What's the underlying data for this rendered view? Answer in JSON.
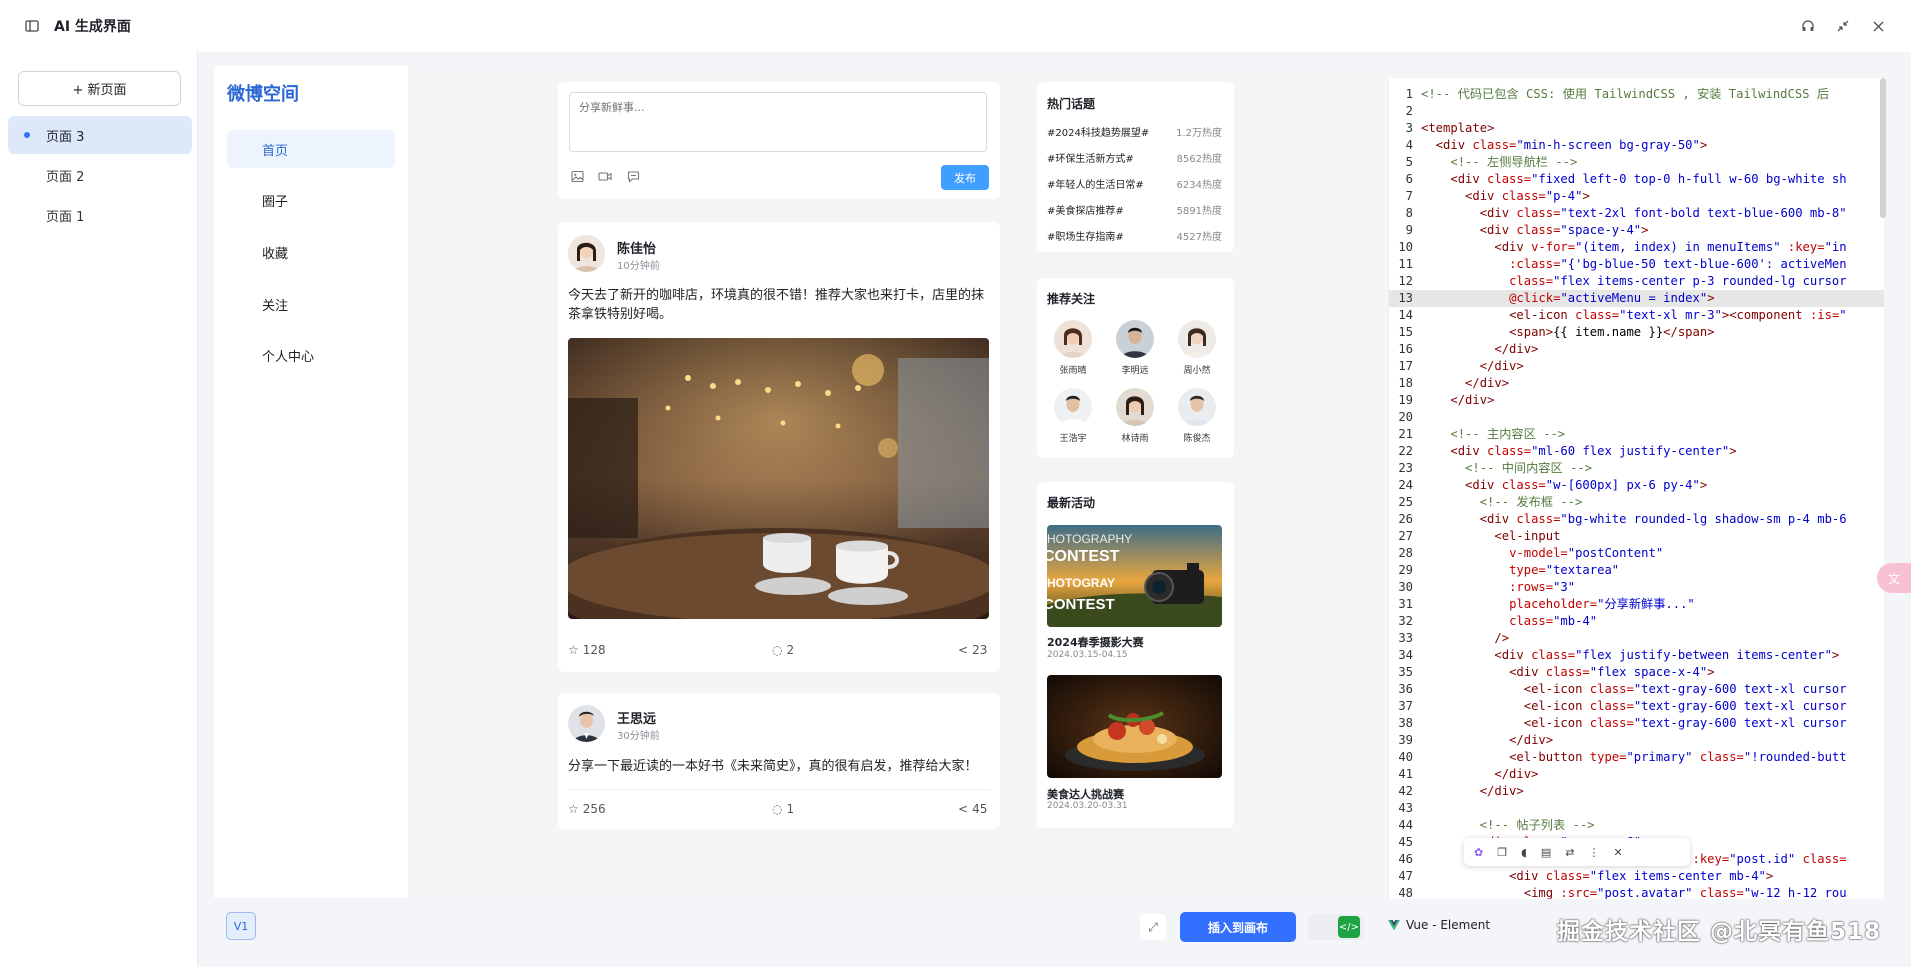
{
  "app": {
    "title": "AI 生成界面"
  },
  "pages_panel": {
    "new_page_label": "+ 新页面",
    "items": [
      {
        "label": "页面 3",
        "active": true
      },
      {
        "label": "页面 2"
      },
      {
        "label": "页面 1"
      }
    ]
  },
  "sidenav": {
    "brand": "微博空间",
    "items": [
      {
        "label": "首页",
        "active": true
      },
      {
        "label": "圈子"
      },
      {
        "label": "收藏"
      },
      {
        "label": "关注"
      },
      {
        "label": "个人中心"
      }
    ]
  },
  "composer": {
    "placeholder": "分享新鲜事...",
    "publish_label": "发布"
  },
  "posts": [
    {
      "name": "陈佳怡",
      "time": "10分钟前",
      "text": "今天去了新开的咖啡店，环境真的很不错！推荐大家也来打卡，店里的抹茶拿铁特别好喝。",
      "likes": "128",
      "comments": "2",
      "shares": "23"
    },
    {
      "name": "王思远",
      "time": "30分钟前",
      "text": "分享一下最近读的一本好书《未来简史》，真的很有启发，推荐给大家！",
      "likes": "256",
      "comments": "1",
      "shares": "45"
    }
  ],
  "hot_topics": {
    "title": "热门话题",
    "items": [
      {
        "name": "#2024科技趋势展望#",
        "heat": "1.2万热度"
      },
      {
        "name": "#环保生活新方式#",
        "heat": "8562热度"
      },
      {
        "name": "#年轻人的生活日常#",
        "heat": "6234热度"
      },
      {
        "name": "#美食探店推荐#",
        "heat": "5891热度"
      },
      {
        "name": "#职场生存指南#",
        "heat": "4527热度"
      }
    ]
  },
  "recommend": {
    "title": "推荐关注",
    "users": [
      "张雨晴",
      "李明远",
      "周小然",
      "王浩宇",
      "林诗雨",
      "陈俊杰"
    ]
  },
  "events": {
    "title": "最新活动",
    "items": [
      {
        "title": "2024春季摄影大赛",
        "date": "2024.03.15-04.15",
        "banner": "PHOTOGRAPHY CONTEST"
      },
      {
        "title": "美食达人挑战赛",
        "date": "2024.03.20-03.31"
      }
    ]
  },
  "code_lines": [
    [
      {
        "c": "ct",
        "t": "<!-- 代码已包含 CSS: 使用 TailwindCSS , 安装 TailwindCSS 后"
      }
    ],
    [],
    [
      {
        "c": "tg",
        "t": "<template>"
      }
    ],
    [
      {
        "c": "tx",
        "t": "  "
      },
      {
        "c": "tg",
        "t": "<div "
      },
      {
        "c": "at",
        "t": "class="
      },
      {
        "c": "sv",
        "t": "\"min-h-screen bg-gray-50\""
      },
      {
        "c": "tg",
        "t": ">"
      }
    ],
    [
      {
        "c": "tx",
        "t": "    "
      },
      {
        "c": "ct",
        "t": "<!-- 左侧导航栏 -->"
      }
    ],
    [
      {
        "c": "tx",
        "t": "    "
      },
      {
        "c": "tg",
        "t": "<div "
      },
      {
        "c": "at",
        "t": "class="
      },
      {
        "c": "sv",
        "t": "\"fixed left-0 top-0 h-full w-60 bg-white sh"
      }
    ],
    [
      {
        "c": "tx",
        "t": "      "
      },
      {
        "c": "tg",
        "t": "<div "
      },
      {
        "c": "at",
        "t": "class="
      },
      {
        "c": "sv",
        "t": "\"p-4\""
      },
      {
        "c": "tg",
        "t": ">"
      }
    ],
    [
      {
        "c": "tx",
        "t": "        "
      },
      {
        "c": "tg",
        "t": "<div "
      },
      {
        "c": "at",
        "t": "class="
      },
      {
        "c": "sv",
        "t": "\"text-2xl font-bold text-blue-600 mb-8\""
      }
    ],
    [
      {
        "c": "tx",
        "t": "        "
      },
      {
        "c": "tg",
        "t": "<div "
      },
      {
        "c": "at",
        "t": "class="
      },
      {
        "c": "sv",
        "t": "\"space-y-4\""
      },
      {
        "c": "tg",
        "t": ">"
      }
    ],
    [
      {
        "c": "tx",
        "t": "          "
      },
      {
        "c": "tg",
        "t": "<div "
      },
      {
        "c": "at",
        "t": "v-for="
      },
      {
        "c": "sv",
        "t": "\"(item, index) in menuItems\""
      },
      {
        "c": "at",
        "t": " :key="
      },
      {
        "c": "sv",
        "t": "\"in"
      }
    ],
    [
      {
        "c": "tx",
        "t": "            "
      },
      {
        "c": "at",
        "t": ":class="
      },
      {
        "c": "sv",
        "t": "\"{'bg-blue-50 text-blue-600': activeMen"
      }
    ],
    [
      {
        "c": "tx",
        "t": "            "
      },
      {
        "c": "at",
        "t": "class="
      },
      {
        "c": "sv",
        "t": "\"flex items-center p-3 rounded-lg cursor"
      }
    ],
    [
      {
        "c": "tx",
        "t": "            "
      },
      {
        "c": "at",
        "t": "@click="
      },
      {
        "c": "sv",
        "t": "\"activeMenu = index\""
      },
      {
        "c": "tg",
        "t": ">"
      }
    ],
    [
      {
        "c": "tx",
        "t": "            "
      },
      {
        "c": "tg",
        "t": "<el-icon "
      },
      {
        "c": "at",
        "t": "class="
      },
      {
        "c": "sv",
        "t": "\"text-xl mr-3\""
      },
      {
        "c": "tg",
        "t": "><component "
      },
      {
        "c": "at",
        "t": ":is="
      },
      {
        "c": "sv",
        "t": "\""
      }
    ],
    [
      {
        "c": "tx",
        "t": "            "
      },
      {
        "c": "tg",
        "t": "<span>"
      },
      {
        "c": "tx",
        "t": "{{ item.name }}"
      },
      {
        "c": "tg",
        "t": "</span>"
      }
    ],
    [
      {
        "c": "tx",
        "t": "          "
      },
      {
        "c": "tg",
        "t": "</div>"
      }
    ],
    [
      {
        "c": "tx",
        "t": "        "
      },
      {
        "c": "tg",
        "t": "</div>"
      }
    ],
    [
      {
        "c": "tx",
        "t": "      "
      },
      {
        "c": "tg",
        "t": "</div>"
      }
    ],
    [
      {
        "c": "tx",
        "t": "    "
      },
      {
        "c": "tg",
        "t": "</div>"
      }
    ],
    [],
    [
      {
        "c": "tx",
        "t": "    "
      },
      {
        "c": "ct",
        "t": "<!-- 主内容区 -->"
      }
    ],
    [
      {
        "c": "tx",
        "t": "    "
      },
      {
        "c": "tg",
        "t": "<div "
      },
      {
        "c": "at",
        "t": "class="
      },
      {
        "c": "sv",
        "t": "\"ml-60 flex justify-center\""
      },
      {
        "c": "tg",
        "t": ">"
      }
    ],
    [
      {
        "c": "tx",
        "t": "      "
      },
      {
        "c": "ct",
        "t": "<!-- 中间内容区 -->"
      }
    ],
    [
      {
        "c": "tx",
        "t": "      "
      },
      {
        "c": "tg",
        "t": "<div "
      },
      {
        "c": "at",
        "t": "class="
      },
      {
        "c": "sv",
        "t": "\"w-[600px] px-6 py-4\""
      },
      {
        "c": "tg",
        "t": ">"
      }
    ],
    [
      {
        "c": "tx",
        "t": "        "
      },
      {
        "c": "ct",
        "t": "<!-- 发布框 -->"
      }
    ],
    [
      {
        "c": "tx",
        "t": "        "
      },
      {
        "c": "tg",
        "t": "<div "
      },
      {
        "c": "at",
        "t": "class="
      },
      {
        "c": "sv",
        "t": "\"bg-white rounded-lg shadow-sm p-4 mb-6"
      }
    ],
    [
      {
        "c": "tx",
        "t": "          "
      },
      {
        "c": "tg",
        "t": "<el-input"
      }
    ],
    [
      {
        "c": "tx",
        "t": "            "
      },
      {
        "c": "at",
        "t": "v-model="
      },
      {
        "c": "sv",
        "t": "\"postContent\""
      }
    ],
    [
      {
        "c": "tx",
        "t": "            "
      },
      {
        "c": "at",
        "t": "type="
      },
      {
        "c": "sv",
        "t": "\"textarea\""
      }
    ],
    [
      {
        "c": "tx",
        "t": "            "
      },
      {
        "c": "at",
        "t": ":rows="
      },
      {
        "c": "sv",
        "t": "\"3\""
      }
    ],
    [
      {
        "c": "tx",
        "t": "            "
      },
      {
        "c": "at",
        "t": "placeholder="
      },
      {
        "c": "sv",
        "t": "\"分享新鲜事...\""
      }
    ],
    [
      {
        "c": "tx",
        "t": "            "
      },
      {
        "c": "at",
        "t": "class="
      },
      {
        "c": "sv",
        "t": "\"mb-4\""
      }
    ],
    [
      {
        "c": "tx",
        "t": "          "
      },
      {
        "c": "tg",
        "t": "/>"
      }
    ],
    [
      {
        "c": "tx",
        "t": "          "
      },
      {
        "c": "tg",
        "t": "<div "
      },
      {
        "c": "at",
        "t": "class="
      },
      {
        "c": "sv",
        "t": "\"flex justify-between items-center\""
      },
      {
        "c": "tg",
        "t": ">"
      }
    ],
    [
      {
        "c": "tx",
        "t": "            "
      },
      {
        "c": "tg",
        "t": "<div "
      },
      {
        "c": "at",
        "t": "class="
      },
      {
        "c": "sv",
        "t": "\"flex space-x-4\""
      },
      {
        "c": "tg",
        "t": ">"
      }
    ],
    [
      {
        "c": "tx",
        "t": "              "
      },
      {
        "c": "tg",
        "t": "<el-icon "
      },
      {
        "c": "at",
        "t": "class="
      },
      {
        "c": "sv",
        "t": "\"text-gray-600 text-xl cursor"
      }
    ],
    [
      {
        "c": "tx",
        "t": "              "
      },
      {
        "c": "tg",
        "t": "<el-icon "
      },
      {
        "c": "at",
        "t": "class="
      },
      {
        "c": "sv",
        "t": "\"text-gray-600 text-xl cursor"
      }
    ],
    [
      {
        "c": "tx",
        "t": "              "
      },
      {
        "c": "tg",
        "t": "<el-icon "
      },
      {
        "c": "at",
        "t": "class="
      },
      {
        "c": "sv",
        "t": "\"text-gray-600 text-xl cursor"
      }
    ],
    [
      {
        "c": "tx",
        "t": "            "
      },
      {
        "c": "tg",
        "t": "</div>"
      }
    ],
    [
      {
        "c": "tx",
        "t": "            "
      },
      {
        "c": "tg",
        "t": "<el-button "
      },
      {
        "c": "at",
        "t": "type="
      },
      {
        "c": "sv",
        "t": "\"primary\""
      },
      {
        "c": "at",
        "t": " class="
      },
      {
        "c": "sv",
        "t": "\"!rounded-butt"
      }
    ],
    [
      {
        "c": "tx",
        "t": "          "
      },
      {
        "c": "tg",
        "t": "</div>"
      }
    ],
    [
      {
        "c": "tx",
        "t": "        "
      },
      {
        "c": "tg",
        "t": "</div>"
      }
    ],
    [],
    [
      {
        "c": "tx",
        "t": "        "
      },
      {
        "c": "ct",
        "t": "<!-- 帖子列表 -->"
      }
    ],
    [
      {
        "c": "tx",
        "t": "        "
      },
      {
        "c": "tg",
        "t": "<div "
      },
      {
        "c": "at",
        "t": "class="
      },
      {
        "c": "sv",
        "t": "\"space-y-6\""
      },
      {
        "c": "tg",
        "t": ">"
      }
    ],
    [
      {
        "c": "tx",
        "t": "          "
      },
      {
        "c": "tg",
        "t": "<div "
      },
      {
        "c": "at",
        "t": "v-for="
      },
      {
        "c": "sv",
        "t": "\"post in posts\""
      },
      {
        "c": "at",
        "t": " :key="
      },
      {
        "c": "sv",
        "t": "\"post.id\""
      },
      {
        "c": "at",
        "t": " class="
      }
    ],
    [
      {
        "c": "tx",
        "t": "            "
      },
      {
        "c": "tg",
        "t": "<div "
      },
      {
        "c": "at",
        "t": "class="
      },
      {
        "c": "sv",
        "t": "\"flex items-center mb-4\""
      },
      {
        "c": "tg",
        "t": ">"
      }
    ],
    [
      {
        "c": "tx",
        "t": "              "
      },
      {
        "c": "tg",
        "t": "<img "
      },
      {
        "c": "at",
        "t": ":src="
      },
      {
        "c": "sv",
        "t": "\"post.avatar\""
      },
      {
        "c": "at",
        "t": " class="
      },
      {
        "c": "sv",
        "t": "\"w-12 h-12 rou"
      }
    ]
  ],
  "bottom": {
    "version": "V1",
    "insert_label": "插入到画布",
    "framework": "Vue - Element"
  },
  "watermark": "掘金技术社区 @北冥有鱼518",
  "colors": {
    "accent": "#3370ff",
    "brand": "#2c67d6",
    "publish": "#409eff",
    "toggle": "#1fa344"
  }
}
